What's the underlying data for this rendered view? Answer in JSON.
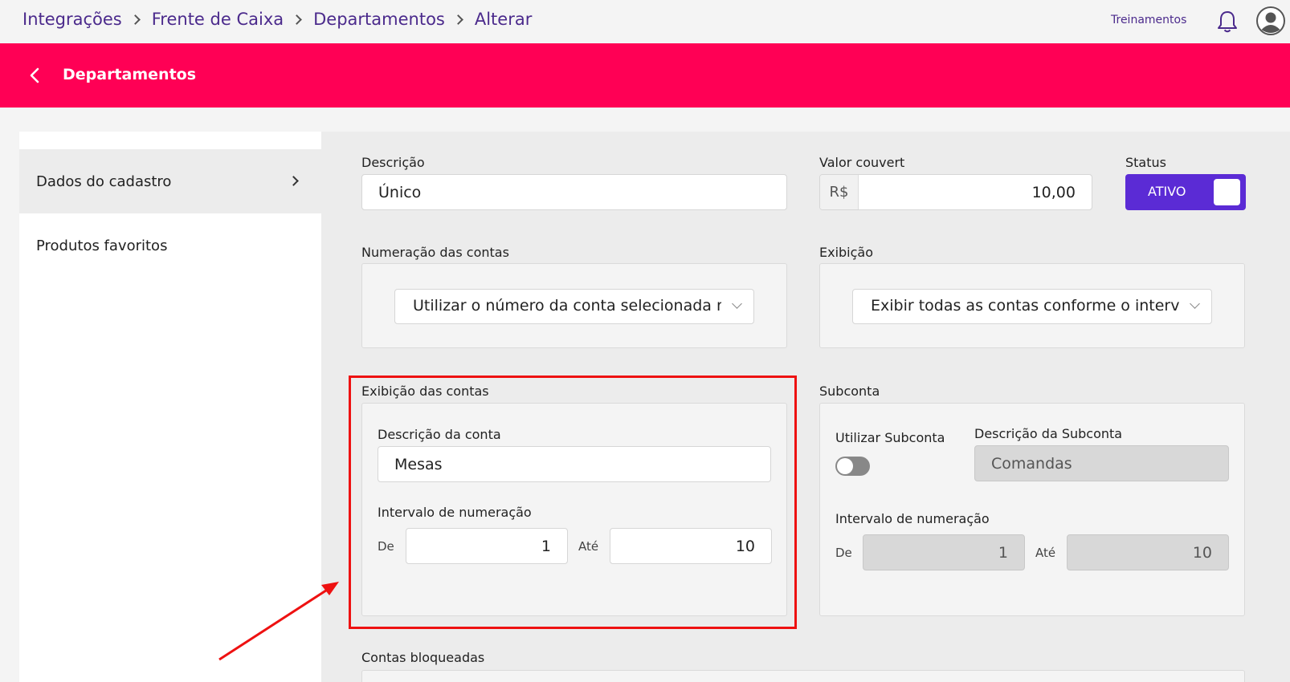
{
  "breadcrumb": [
    "Integrações",
    "Frente de Caixa",
    "Departamentos",
    "Alterar"
  ],
  "top_link": "Treinamentos",
  "header_title": "Departamentos",
  "sidebar": {
    "items": [
      {
        "label": "Dados do cadastro",
        "active": true
      },
      {
        "label": "Produtos favoritos",
        "active": false
      }
    ]
  },
  "form": {
    "descricao": {
      "label": "Descrição",
      "value": "Único"
    },
    "valor_couvert": {
      "label": "Valor couvert",
      "prefix": "R$",
      "value": "10,00"
    },
    "status": {
      "label": "Status",
      "value": "ATIVO"
    },
    "numeracao_contas": {
      "label": "Numeração das contas",
      "selected": "Utilizar o número da conta selecionada na tela"
    },
    "exibicao": {
      "label": "Exibição",
      "selected": "Exibir todas as contas conforme o intervalo"
    },
    "exibicao_contas": {
      "label": "Exibição das contas",
      "descricao_label": "Descrição da conta",
      "descricao_value": "Mesas",
      "intervalo_label": "Intervalo de numeração",
      "de_label": "De",
      "de_value": "1",
      "ate_label": "Até",
      "ate_value": "10"
    },
    "subconta": {
      "label": "Subconta",
      "utilizar_label": "Utilizar Subconta",
      "utilizar_on": false,
      "descricao_label": "Descrição da Subconta",
      "descricao_value": "Comandas",
      "intervalo_label": "Intervalo de numeração",
      "de_label": "De",
      "de_value": "1",
      "ate_label": "Até",
      "ate_value": "10"
    },
    "contas_bloqueadas": {
      "label": "Contas bloqueadas"
    }
  },
  "colors": {
    "header": "#ff0055",
    "accent": "#5b2bd5",
    "highlight": "#ee1111"
  },
  "icons": [
    "chevron-right-icon",
    "bell-icon",
    "user-avatar-icon",
    "back-arrow-icon",
    "chevron-down-icon"
  ]
}
